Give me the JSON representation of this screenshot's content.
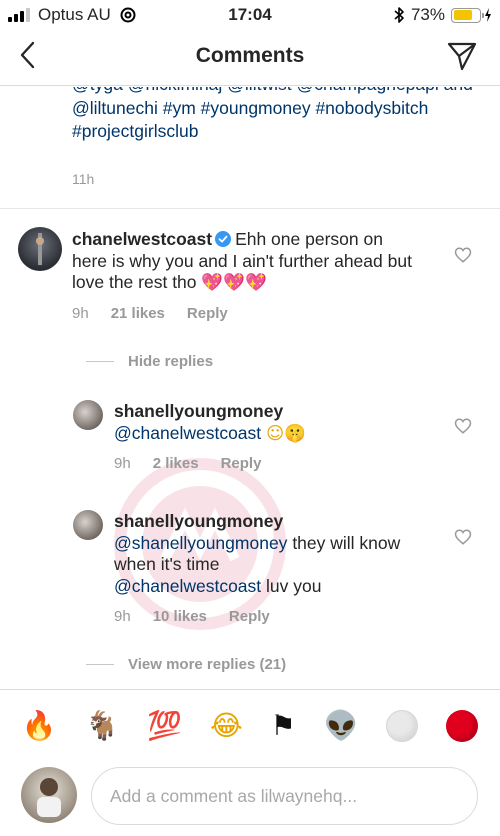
{
  "status_bar": {
    "carrier": "Optus AU",
    "time": "17:04",
    "battery": "73%",
    "battery_level": 0.73
  },
  "nav": {
    "title": "Comments"
  },
  "caption": {
    "text": "@tyga @nickiminaj @liltwist @champagnepapi and @liltunechi #ym #youngmoney #nobodysbitch #projectgirlsclub",
    "time": "11h"
  },
  "comment": {
    "username": "chanelwestcoast",
    "text": "Ehh one person on here is why you and I ain't further ahead but love the rest tho",
    "emojis": "💖💖💖",
    "time": "9h",
    "likes": "21 likes",
    "reply": "Reply"
  },
  "hide_replies": "Hide replies",
  "replies": [
    {
      "username": "shanellyoungmoney",
      "mention": "@chanelwestcoast",
      "text": "",
      "emojis": "☺🤫",
      "time": "9h",
      "likes": "2 likes",
      "reply": "Reply"
    },
    {
      "username": "shanellyoungmoney",
      "mention": "@shanellyoungmoney",
      "text": "they will know when it's time",
      "mention2": "@chanelwestcoast",
      "text2": "luv you",
      "time": "9h",
      "likes": "10 likes",
      "reply": "Reply"
    }
  ],
  "view_more_replies": "View more replies (21)",
  "emoji_bar": [
    "🔥",
    "🐐",
    "💯",
    "😂",
    "⚑",
    "👽",
    "white-circle",
    "red-circle"
  ],
  "composer": {
    "placeholder": "Add a comment as lilwaynehq..."
  }
}
